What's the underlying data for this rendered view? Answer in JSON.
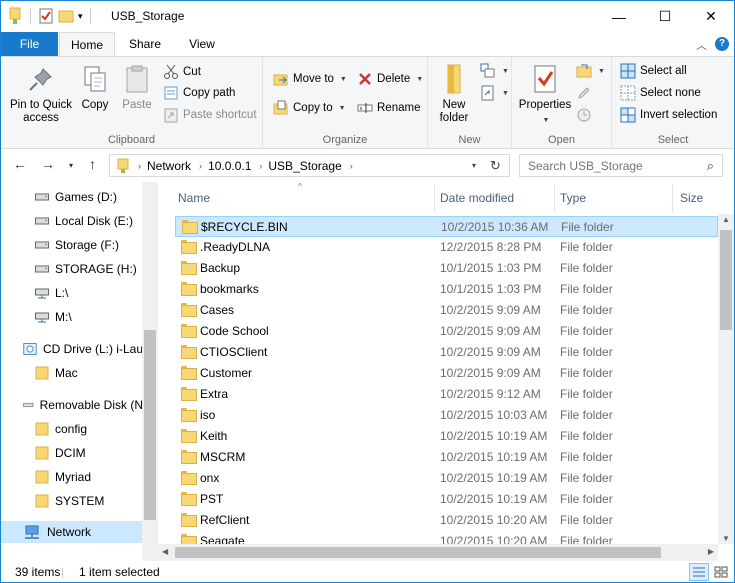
{
  "window": {
    "title": "USB_Storage",
    "controls": {
      "minimize": "—",
      "maximize": "☐",
      "close": "✕"
    }
  },
  "tabs": {
    "file": "File",
    "home": "Home",
    "share": "Share",
    "view": "View"
  },
  "ribbon": {
    "clipboard": {
      "label": "Clipboard",
      "pin": "Pin to Quick access",
      "copy": "Copy",
      "paste": "Paste",
      "cut": "Cut",
      "copy_path": "Copy path",
      "paste_shortcut": "Paste shortcut"
    },
    "organize": {
      "label": "Organize",
      "move_to": "Move to",
      "copy_to": "Copy to",
      "delete": "Delete",
      "rename": "Rename"
    },
    "new": {
      "label": "New",
      "new_folder": "New folder"
    },
    "open": {
      "label": "Open",
      "properties": "Properties"
    },
    "select": {
      "label": "Select",
      "select_all": "Select all",
      "select_none": "Select none",
      "invert_selection": "Invert selection"
    }
  },
  "address": {
    "crumbs": [
      "Network",
      "10.0.0.1",
      "USB_Storage"
    ],
    "search_placeholder": "Search USB_Storage"
  },
  "navpane": {
    "items": [
      {
        "label": "Games (D:)",
        "icon": "drive-icon"
      },
      {
        "label": "Local Disk (E:)",
        "icon": "drive-icon"
      },
      {
        "label": "Storage (F:)",
        "icon": "drive-icon"
      },
      {
        "label": "STORAGE (H:)",
        "icon": "drive-icon"
      },
      {
        "label": "L:\\",
        "icon": "network-drive-icon"
      },
      {
        "label": "M:\\",
        "icon": "network-drive-icon"
      },
      {
        "label": "CD Drive (L:) i-Lau",
        "icon": "cd-drive-icon"
      },
      {
        "label": "Mac",
        "icon": "folder-icon"
      },
      {
        "label": "Removable Disk (N",
        "icon": "usb-drive-icon"
      },
      {
        "label": "config",
        "icon": "folder-icon"
      },
      {
        "label": "DCIM",
        "icon": "folder-icon"
      },
      {
        "label": "Myriad",
        "icon": "folder-icon"
      },
      {
        "label": "SYSTEM",
        "icon": "folder-icon"
      },
      {
        "label": "Network",
        "icon": "network-icon"
      }
    ]
  },
  "filelist": {
    "columns": {
      "name": "Name",
      "date": "Date modified",
      "type": "Type",
      "size": "Size"
    },
    "rows": [
      {
        "name": "$RECYCLE.BIN",
        "date": "10/2/2015 10:36 AM",
        "type": "File folder"
      },
      {
        "name": ".ReadyDLNA",
        "date": "12/2/2015 8:28 PM",
        "type": "File folder"
      },
      {
        "name": "Backup",
        "date": "10/1/2015 1:03 PM",
        "type": "File folder"
      },
      {
        "name": "bookmarks",
        "date": "10/1/2015 1:03 PM",
        "type": "File folder"
      },
      {
        "name": "Cases",
        "date": "10/2/2015 9:09 AM",
        "type": "File folder"
      },
      {
        "name": "Code School",
        "date": "10/2/2015 9:09 AM",
        "type": "File folder"
      },
      {
        "name": "CTIOSClient",
        "date": "10/2/2015 9:09 AM",
        "type": "File folder"
      },
      {
        "name": "Customer",
        "date": "10/2/2015 9:09 AM",
        "type": "File folder"
      },
      {
        "name": "Extra",
        "date": "10/2/2015 9:12 AM",
        "type": "File folder"
      },
      {
        "name": "iso",
        "date": "10/2/2015 10:03 AM",
        "type": "File folder"
      },
      {
        "name": "Keith",
        "date": "10/2/2015 10:19 AM",
        "type": "File folder"
      },
      {
        "name": "MSCRM",
        "date": "10/2/2015 10:19 AM",
        "type": "File folder"
      },
      {
        "name": "onx",
        "date": "10/2/2015 10:19 AM",
        "type": "File folder"
      },
      {
        "name": "PST",
        "date": "10/2/2015 10:19 AM",
        "type": "File folder"
      },
      {
        "name": "RefClient",
        "date": "10/2/2015 10:20 AM",
        "type": "File folder"
      },
      {
        "name": "Seagate",
        "date": "10/2/2015 10:20 AM",
        "type": "File folder"
      }
    ]
  },
  "status": {
    "items_count": "39 items",
    "selected": "1 item selected"
  },
  "colors": {
    "accent": "#1979ca",
    "selection": "#cce8ff",
    "selection_border": "#99d1ff",
    "folder": "#f8d775"
  }
}
